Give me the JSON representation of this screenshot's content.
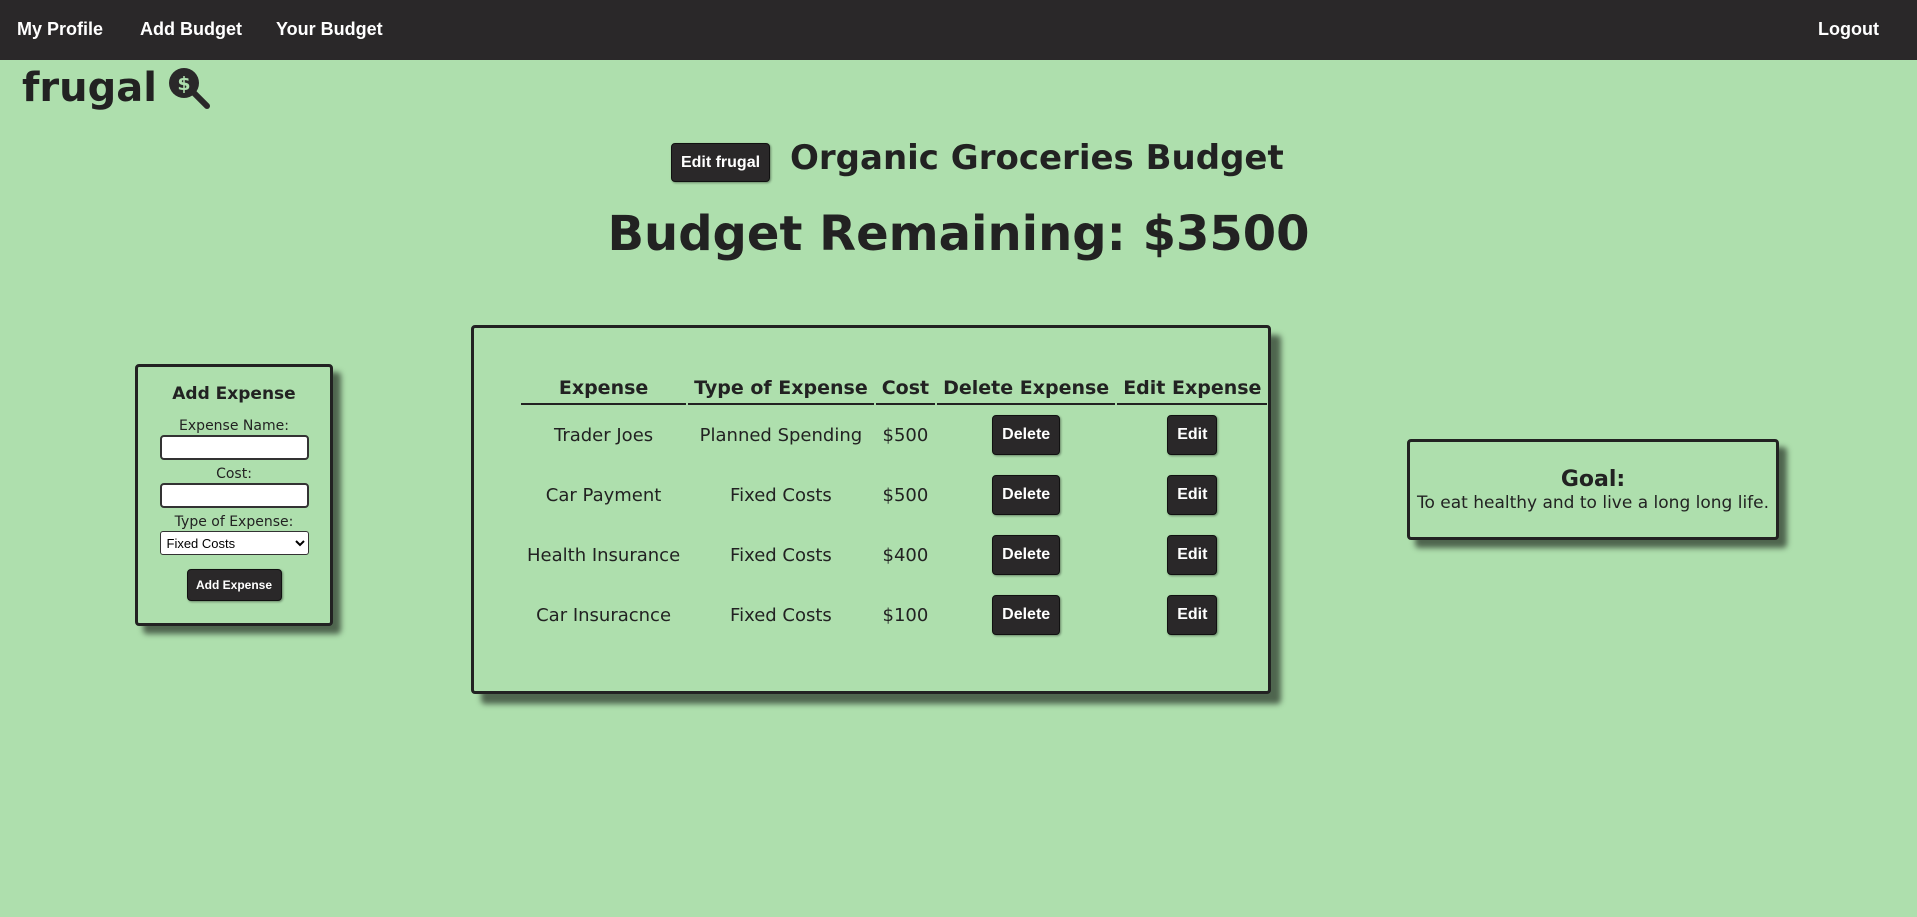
{
  "nav": {
    "my_profile": "My Profile",
    "add_budget": "Add Budget",
    "your_budget": "Your Budget",
    "logout": "Logout"
  },
  "logo": {
    "text": "frugal",
    "icon": "magnifier-dollar-icon"
  },
  "header": {
    "edit_button": "Edit frugal",
    "budget_title": "Organic Groceries Budget",
    "budget_remaining": "Budget Remaining: $3500"
  },
  "add_expense": {
    "title": "Add Expense",
    "name_label": "Expense Name:",
    "name_value": "",
    "cost_label": "Cost:",
    "cost_value": "",
    "type_label": "Type of Expense:",
    "type_selected": "Fixed Costs",
    "submit_label": "Add Expense"
  },
  "expenses": {
    "headers": [
      "Expense",
      "Type of Expense",
      "Cost",
      "Delete Expense",
      "Edit Expense"
    ],
    "rows": [
      {
        "name": "Trader Joes",
        "type": "Planned Spending",
        "cost": "$500",
        "delete": "Delete",
        "edit": "Edit"
      },
      {
        "name": "Car Payment",
        "type": "Fixed Costs",
        "cost": "$500",
        "delete": "Delete",
        "edit": "Edit"
      },
      {
        "name": "Health Insurance",
        "type": "Fixed Costs",
        "cost": "$400",
        "delete": "Delete",
        "edit": "Edit"
      },
      {
        "name": "Car Insuracnce",
        "type": "Fixed Costs",
        "cost": "$100",
        "delete": "Delete",
        "edit": "Edit"
      }
    ]
  },
  "goal": {
    "title": "Goal:",
    "text": "To eat healthy and to live a long long life."
  },
  "colors": {
    "background": "#aedfad",
    "navbar": "#2a2829",
    "button": "#2a2829",
    "text": "#222222"
  }
}
